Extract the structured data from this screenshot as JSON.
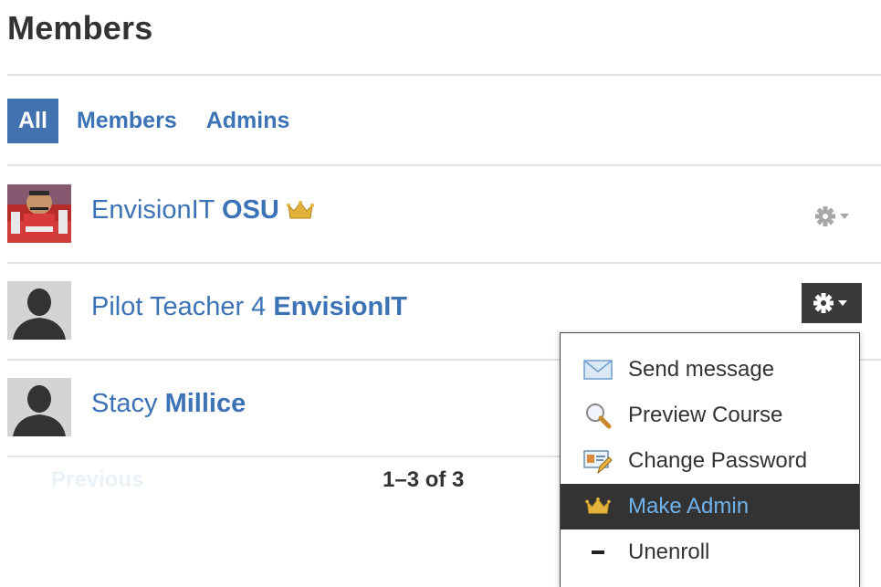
{
  "page": {
    "title": "Members"
  },
  "tabs": [
    {
      "label": "All",
      "active": true
    },
    {
      "label": "Members",
      "active": false
    },
    {
      "label": "Admins",
      "active": false
    }
  ],
  "members": [
    {
      "first": "EnvisionIT",
      "last": "OSU",
      "is_admin": true,
      "avatar": "photo",
      "menu_open": false
    },
    {
      "first": "Pilot Teacher 4",
      "last": "EnvisionIT",
      "is_admin": false,
      "avatar": "default-silhouette",
      "menu_open": true
    },
    {
      "first": "Stacy",
      "last": "Millice",
      "is_admin": false,
      "avatar": "default-silhouette",
      "menu_open": false
    }
  ],
  "menu": {
    "items": [
      {
        "label": "Send message",
        "icon": "envelope-icon"
      },
      {
        "label": "Preview Course",
        "icon": "magnifier-icon"
      },
      {
        "label": "Change Password",
        "icon": "id-card-pencil-icon"
      },
      {
        "label": "Make Admin",
        "icon": "crown-icon",
        "highlighted": true
      },
      {
        "label": "Unenroll",
        "icon": "minus-icon"
      }
    ]
  },
  "pagination": {
    "previous_label": "Previous",
    "range": "1–3 of 3"
  },
  "colors": {
    "link": "#3b73b6",
    "active_tab_bg": "#4372b0",
    "menu_highlight_bg": "#333333",
    "menu_highlight_text": "#6fb3ec",
    "crown": "#e3b23c"
  }
}
